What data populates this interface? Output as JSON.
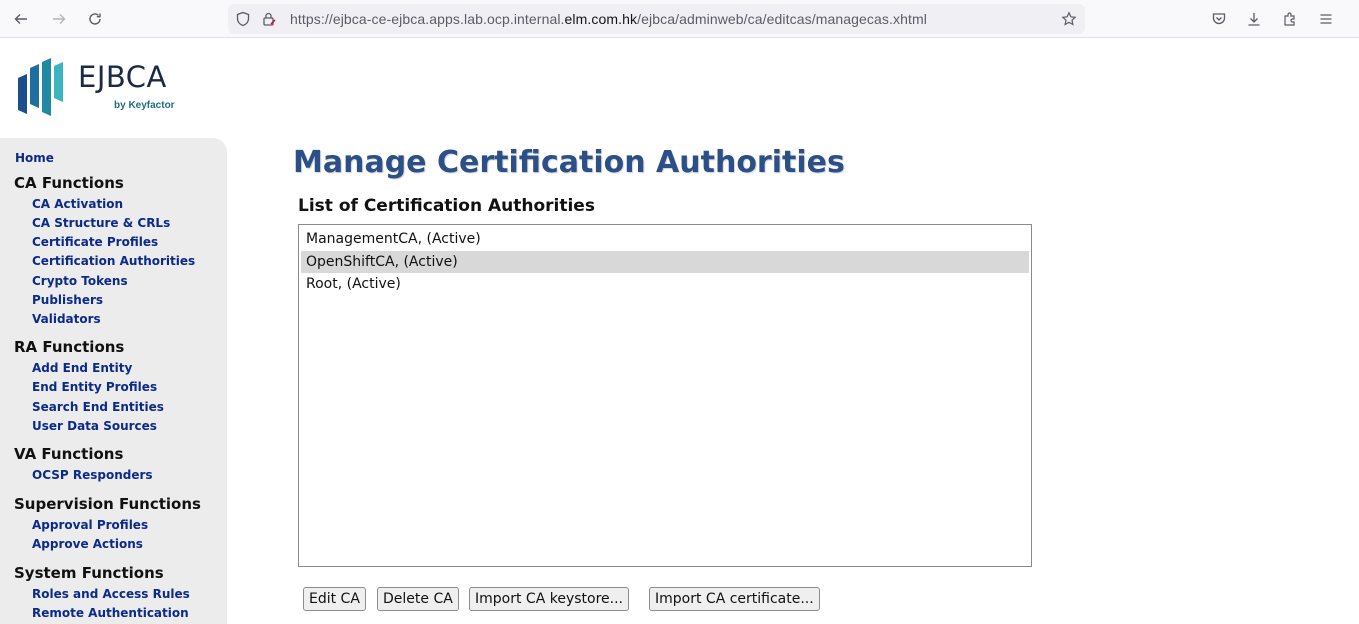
{
  "browser": {
    "url_prefix": "https://ejbca-ce-ejbca.apps.lab.ocp.internal.",
    "url_host": "elm.com.hk",
    "url_path": "/ejbca/adminweb/ca/editcas/managecas.xhtml",
    "icons": [
      "back-icon",
      "forward-icon",
      "reload-icon",
      "shield-icon",
      "lock-icon",
      "star-icon",
      "pocket-icon",
      "download-icon",
      "extensions-icon",
      "menu-icon"
    ]
  },
  "logo": {
    "word": "EJBCA",
    "sub": "by Keyfactor",
    "colors": [
      "#1d4f8c",
      "#1f8aa1",
      "#3cb4c0"
    ]
  },
  "sidebar": {
    "home": "Home",
    "sections": [
      {
        "title": "CA Functions",
        "items": [
          "CA Activation",
          "CA Structure & CRLs",
          "Certificate Profiles",
          "Certification Authorities",
          "Crypto Tokens",
          "Publishers",
          "Validators"
        ]
      },
      {
        "title": "RA Functions",
        "items": [
          "Add End Entity",
          "End Entity Profiles",
          "Search End Entities",
          "User Data Sources"
        ]
      },
      {
        "title": "VA Functions",
        "items": [
          "OCSP Responders"
        ]
      },
      {
        "title": "Supervision Functions",
        "items": [
          "Approval Profiles",
          "Approve Actions"
        ]
      },
      {
        "title": "System Functions",
        "items": [
          "Roles and Access Rules",
          "Remote Authentication"
        ]
      }
    ]
  },
  "main": {
    "title": "Manage Certification Authorities",
    "list_heading": "List of Certification Authorities",
    "ca_options": [
      "ManagementCA, (Active)",
      "OpenShiftCA, (Active)",
      "Root, (Active)"
    ],
    "selected_option": "OpenShiftCA, (Active)",
    "buttons": {
      "edit": "Edit CA",
      "delete": "Delete CA",
      "import_keystore": "Import CA keystore...",
      "import_certificate": "Import CA certificate..."
    }
  },
  "colors": {
    "title": "#2b4f86",
    "nav_link": "#0b2a8a",
    "sidebar_bg": "#ececec"
  }
}
